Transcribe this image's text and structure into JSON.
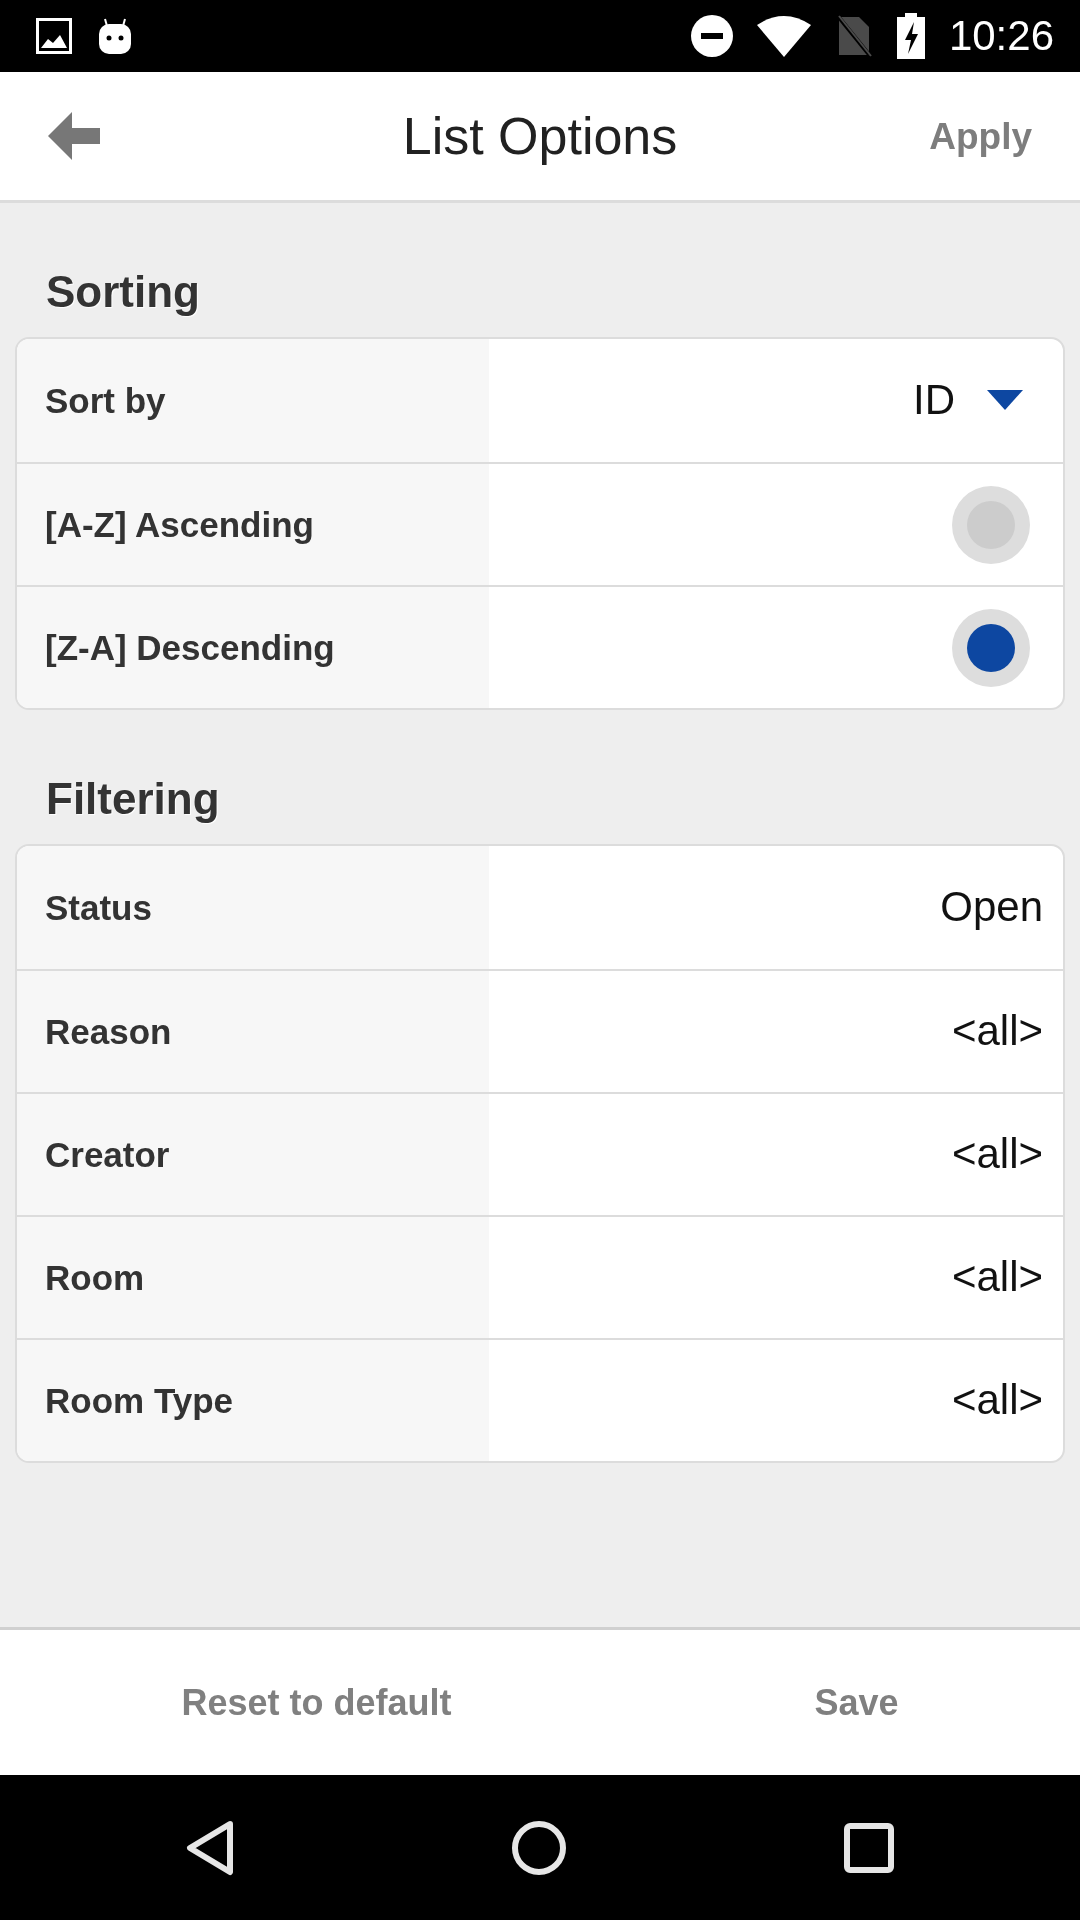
{
  "status_bar": {
    "time": "10:26"
  },
  "header": {
    "title": "List Options",
    "action": "Apply"
  },
  "sections": [
    {
      "title": "Sorting",
      "rows": [
        {
          "kind": "dropdown",
          "label": "Sort by",
          "value": "ID"
        },
        {
          "kind": "radio",
          "label": "[A-Z] Ascending",
          "selected": false
        },
        {
          "kind": "radio",
          "label": "[Z-A] Descending",
          "selected": true
        }
      ]
    },
    {
      "title": "Filtering",
      "rows": [
        {
          "kind": "value",
          "label": "Status",
          "value": "Open"
        },
        {
          "kind": "value",
          "label": "Reason",
          "value": "<all>"
        },
        {
          "kind": "value",
          "label": "Creator",
          "value": "<all>"
        },
        {
          "kind": "value",
          "label": "Room",
          "value": "<all>"
        },
        {
          "kind": "value",
          "label": "Room Type",
          "value": "<all>"
        }
      ]
    }
  ],
  "footer": {
    "buttons": [
      "Reset to default",
      "Save"
    ]
  }
}
